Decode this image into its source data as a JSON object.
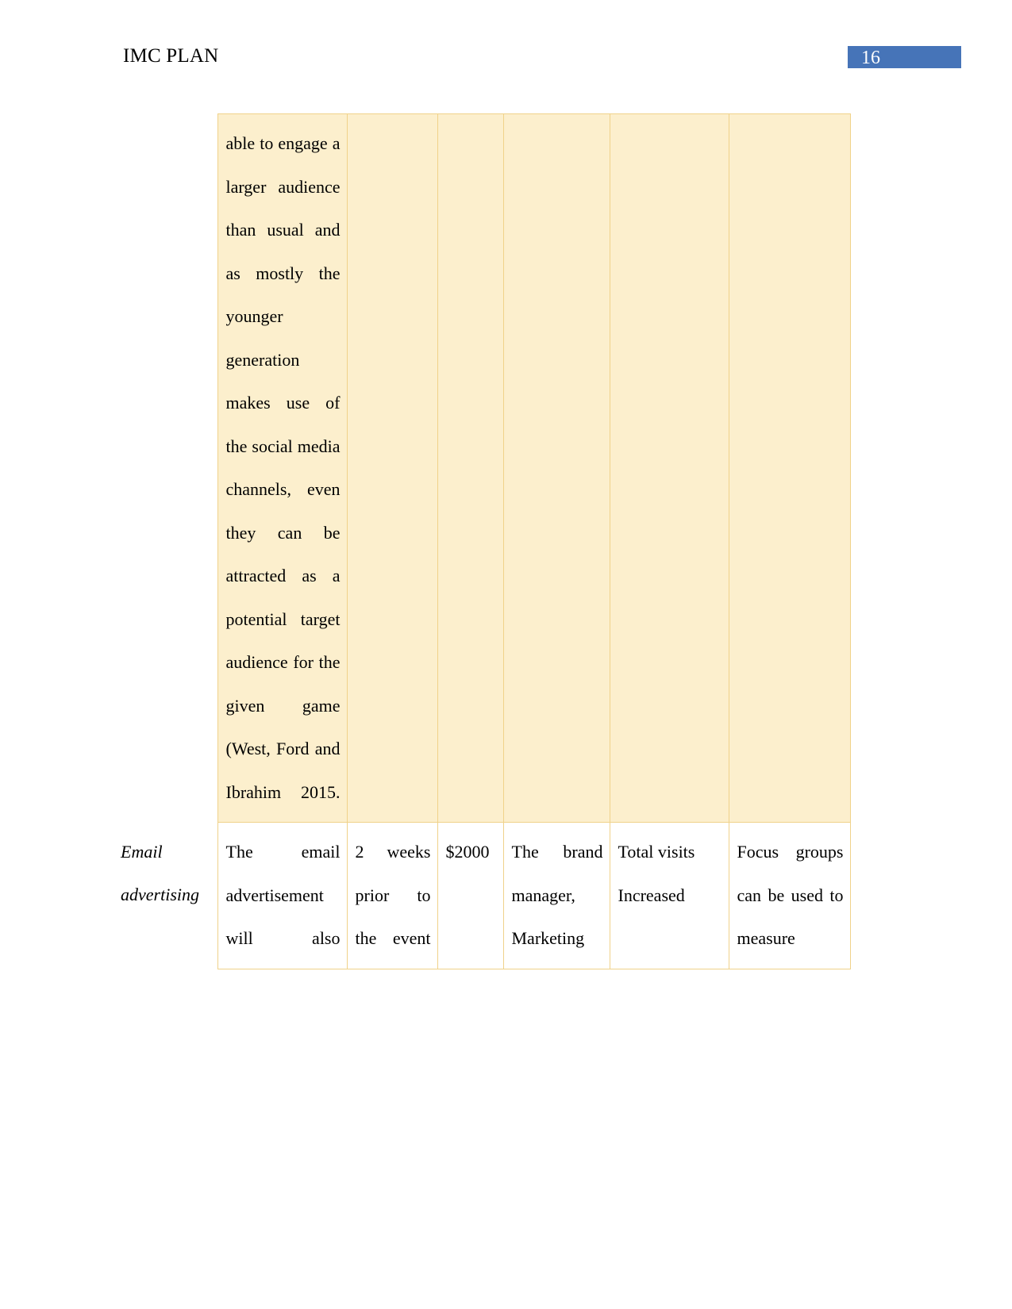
{
  "header": {
    "title": "IMC PLAN",
    "page_number": "16",
    "page_number_box_color": "#4674b8"
  },
  "table": {
    "shaded_row_color": "#fcefcd",
    "border_color": "#f0d28a",
    "rows": [
      {
        "shaded": true,
        "label": "",
        "description": "able to engage a larger audience than usual and as mostly the younger generation makes use of the social media channels, even they can be attracted as a potential target audience for the given game (West, Ford and Ibrahim 2015.",
        "timing": "",
        "budget": "",
        "responsible": "",
        "metric": "",
        "evaluation": ""
      },
      {
        "shaded": false,
        "label": "Email advertising",
        "description": "The email advertisement will also",
        "timing": "2 weeks prior to the event",
        "budget": "$2000",
        "responsible": "The brand manager, Marketing",
        "metric": "Total visits Increased",
        "evaluation": "Focus groups can be used to measure"
      }
    ]
  }
}
